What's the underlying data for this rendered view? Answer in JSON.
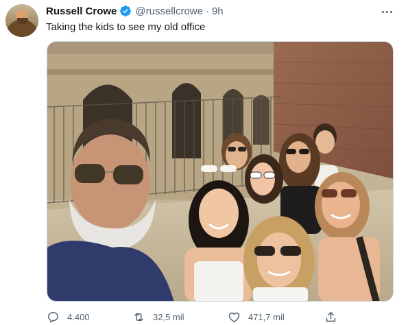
{
  "tweet": {
    "author": {
      "display_name": "Russell Crowe",
      "handle": "@russellcrowe",
      "verified": true
    },
    "time_sep": "·",
    "time": "9h",
    "text": "Taking the kids to see my old office",
    "media": {
      "type": "photo"
    },
    "actions": {
      "reply_count": "4.400",
      "retweet_count": "32,5 mil",
      "like_count": "471,7 mil"
    }
  },
  "icons": {
    "verified": "verified-badge-icon",
    "more": "more-icon",
    "reply": "reply-icon",
    "retweet": "retweet-icon",
    "like": "heart-icon",
    "share": "share-icon"
  },
  "colors": {
    "text_primary": "#0f1419",
    "text_secondary": "#536471",
    "verified_blue": "#1d9bf0",
    "border": "#cfd9de"
  }
}
